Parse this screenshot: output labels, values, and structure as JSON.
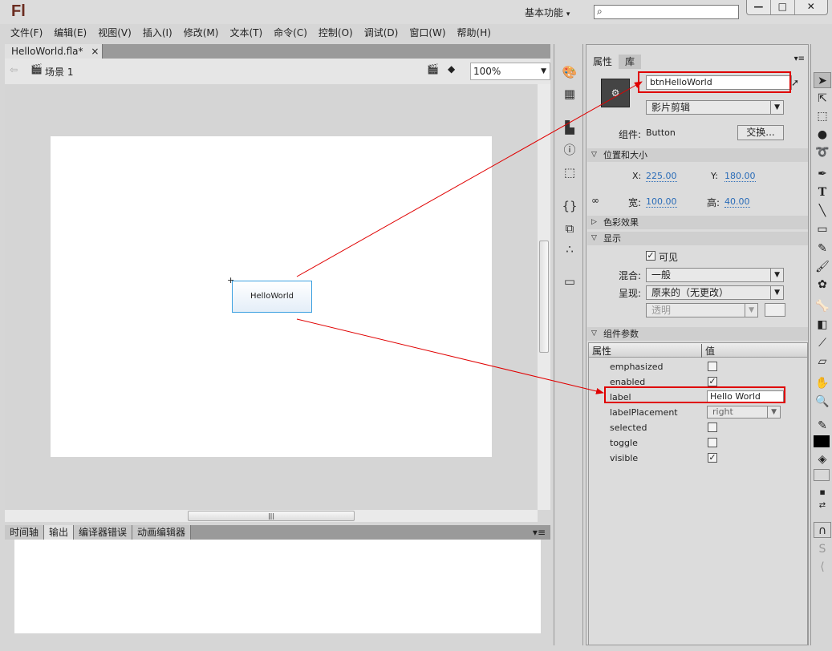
{
  "app": {
    "logo": "Fl",
    "workspace": "基本功能",
    "workspace_arrow": "▾",
    "window_buttons": [
      "—",
      "□",
      "✕"
    ]
  },
  "menu": [
    "文件(F)",
    "编辑(E)",
    "视图(V)",
    "插入(I)",
    "修改(M)",
    "文本(T)",
    "命令(C)",
    "控制(O)",
    "调试(D)",
    "窗口(W)",
    "帮助(H)"
  ],
  "document": {
    "tab": "HelloWorld.fla*",
    "close": "×",
    "scene": "场景 1",
    "zoom": "100%",
    "button_label": "HelloWorld"
  },
  "bottom_panel": {
    "tabs": [
      "时间轴",
      "输出",
      "编译器错误",
      "动画编辑器"
    ],
    "active": "输出"
  },
  "properties": {
    "tabs": [
      "属性",
      "库"
    ],
    "instance_name": "btnHelloWorld",
    "symbol_type": "影片剪辑",
    "component_label": "组件:",
    "component_value": "Button",
    "swap_button": "交换...",
    "section_position": "位置和大小",
    "x_label": "X:",
    "x": "225.00",
    "y_label": "Y:",
    "y": "180.00",
    "w_label": "宽:",
    "w": "100.00",
    "h_label": "高:",
    "h": "40.00",
    "section_color": "色彩效果",
    "section_display": "显示",
    "visible_label": "可见",
    "blend_label": "混合:",
    "blend": "一般",
    "render_label": "呈现:",
    "render": "原来的（无更改）",
    "transparent": "透明",
    "section_params": "组件参数",
    "col_prop": "属性",
    "col_value": "值",
    "params": [
      {
        "name": "emphasized",
        "type": "checkbox",
        "checked": false
      },
      {
        "name": "enabled",
        "type": "checkbox",
        "checked": true
      },
      {
        "name": "label",
        "type": "text",
        "value": "Hello World"
      },
      {
        "name": "labelPlacement",
        "type": "select",
        "value": "right"
      },
      {
        "name": "selected",
        "type": "checkbox",
        "checked": false
      },
      {
        "name": "toggle",
        "type": "checkbox",
        "checked": false
      },
      {
        "name": "visible",
        "type": "checkbox",
        "checked": true
      }
    ]
  },
  "colors": {
    "highlight": "#e00000",
    "accent_value": "#2a6cb8",
    "selection_border": "#3ba0e0"
  }
}
